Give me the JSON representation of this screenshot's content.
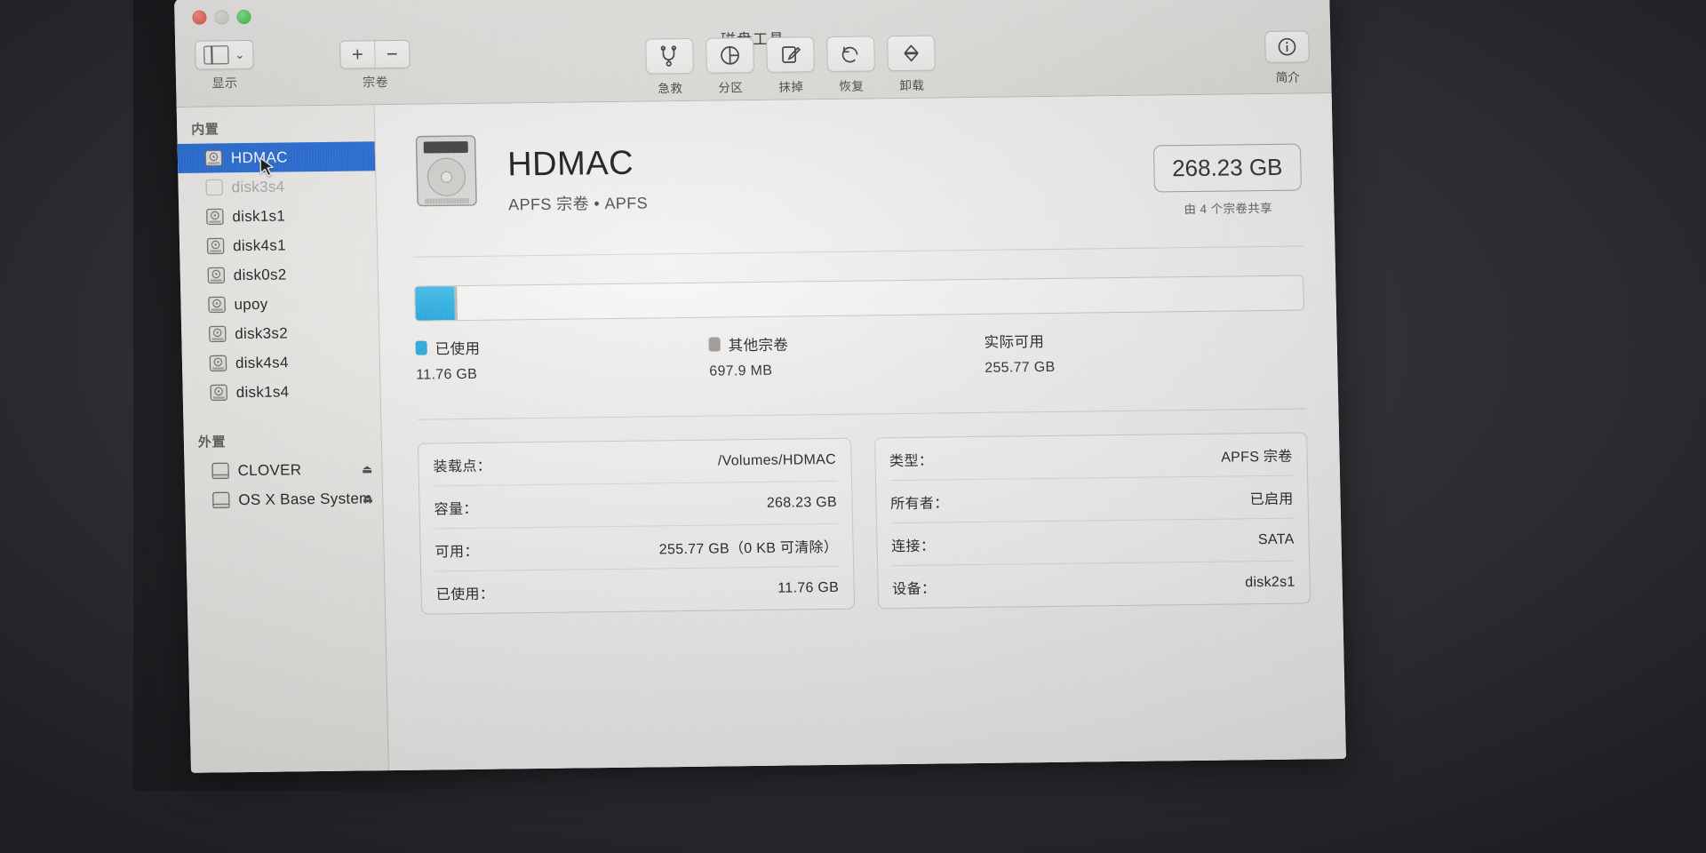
{
  "window": {
    "app_title": "磁盘工具",
    "traffic_lights": [
      "close",
      "minimize",
      "zoom"
    ]
  },
  "toolbar": {
    "view_caption": "显示",
    "volume_caption": "宗卷",
    "add_label": "+",
    "remove_label": "−",
    "tools": [
      {
        "label": "急救",
        "icon": "stethoscope-icon"
      },
      {
        "label": "分区",
        "icon": "pie-chart-icon"
      },
      {
        "label": "抹掉",
        "icon": "erase-icon"
      },
      {
        "label": "恢复",
        "icon": "restore-icon"
      },
      {
        "label": "卸载",
        "icon": "eject-icon"
      }
    ],
    "info_label": "简介"
  },
  "sidebar": {
    "internal_header": "内置",
    "external_header": "外置",
    "internal_items": [
      {
        "label": "HDMAC",
        "selected": true,
        "dimmed": false
      },
      {
        "label": "disk3s4",
        "selected": false,
        "dimmed": true
      },
      {
        "label": "disk1s1",
        "selected": false,
        "dimmed": false
      },
      {
        "label": "disk4s1",
        "selected": false,
        "dimmed": false
      },
      {
        "label": "disk0s2",
        "selected": false,
        "dimmed": false
      },
      {
        "label": "upoy",
        "selected": false,
        "dimmed": false
      },
      {
        "label": "disk3s2",
        "selected": false,
        "dimmed": false
      },
      {
        "label": "disk4s4",
        "selected": false,
        "dimmed": false
      },
      {
        "label": "disk1s4",
        "selected": false,
        "dimmed": false
      }
    ],
    "external_items": [
      {
        "label": "CLOVER",
        "eject": "⏏"
      },
      {
        "label": "OS X Base System",
        "eject": "⏏"
      }
    ]
  },
  "volume": {
    "name": "HDMAC",
    "subtitle": "APFS 宗卷 • APFS",
    "capacity_badge": "268.23 GB",
    "capacity_note": "由 4 个宗卷共享"
  },
  "usage": {
    "used_pct": 4.4,
    "other_pct": 0.3,
    "legend": [
      {
        "name": "已使用",
        "value": "11.76 GB",
        "color": "#1fa9e2"
      },
      {
        "name": "其他宗卷",
        "value": "697.9 MB",
        "color": "#9a9792"
      },
      {
        "name": "实际可用",
        "value": "255.77 GB",
        "color": ""
      }
    ]
  },
  "details": {
    "left": [
      {
        "key": "装载点：",
        "value": "/Volumes/HDMAC"
      },
      {
        "key": "容量：",
        "value": "268.23 GB"
      },
      {
        "key": "可用：",
        "value": "255.77 GB（0 KB 可清除）"
      },
      {
        "key": "已使用：",
        "value": "11.76 GB"
      }
    ],
    "right": [
      {
        "key": "类型：",
        "value": "APFS 宗卷"
      },
      {
        "key": "所有者：",
        "value": "已启用"
      },
      {
        "key": "连接：",
        "value": "SATA"
      },
      {
        "key": "设备：",
        "value": "disk2s1"
      }
    ]
  },
  "colors": {
    "selection_blue": "#1c66dd",
    "used_blue": "#1fa9e2",
    "other_grey": "#9a9792"
  }
}
